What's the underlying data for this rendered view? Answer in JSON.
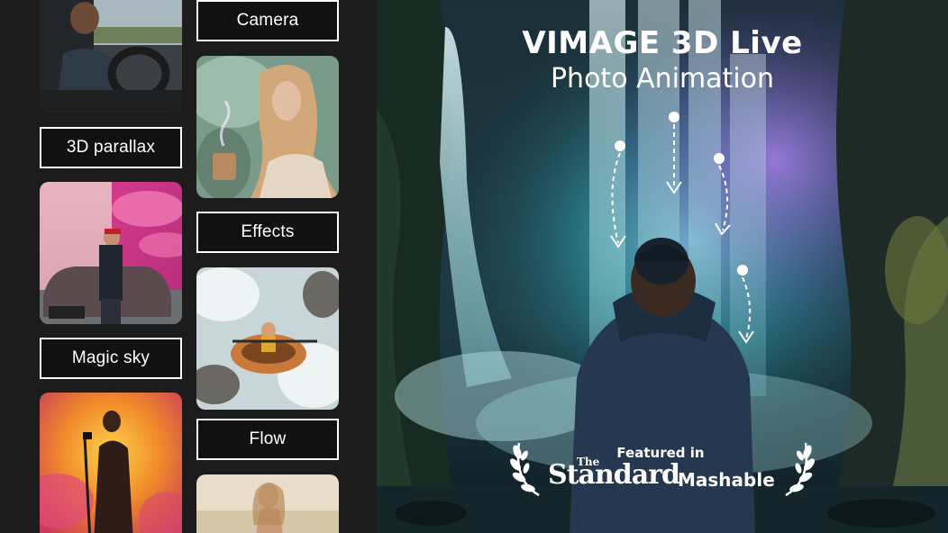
{
  "features": {
    "col1": [
      {
        "label": "3D parallax"
      },
      {
        "label": "Magic sky"
      }
    ],
    "col2": [
      {
        "label": "Camera"
      },
      {
        "label": "Effects"
      },
      {
        "label": "Flow"
      }
    ]
  },
  "hero": {
    "title": "VIMAGE 3D Live",
    "subtitle": "Photo Animation",
    "featured_in": "Featured in",
    "press": {
      "the": "The",
      "standard": "Standard",
      "mashable": "Mashable"
    }
  },
  "colors": {
    "panel_bg": "#1c1c1c",
    "label_bg": "#111111",
    "label_border": "#ffffff",
    "hero_glow": "#5fd3e0",
    "hero_purple": "#8a5cd6"
  },
  "icons": [
    "laurel-left-icon",
    "laurel-right-icon",
    "dashed-arrow-icon"
  ]
}
